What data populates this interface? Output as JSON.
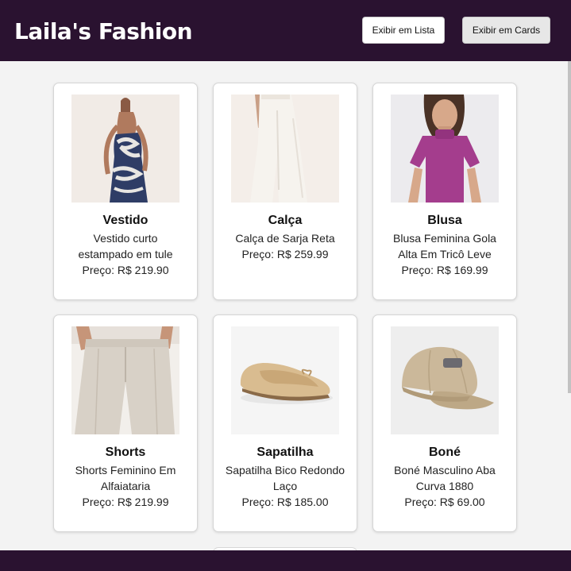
{
  "header": {
    "title": "Laila's Fashion",
    "list_button": "Exibir em Lista",
    "cards_button": "Exibir em Cards"
  },
  "products": [
    {
      "name": "Vestido",
      "description": "Vestido curto estampado em tule",
      "price": "Preço: R$ 219.90",
      "image": "dress-photo"
    },
    {
      "name": "Calça",
      "description": "Calça de Sarja Reta",
      "price": "Preço: R$ 259.99",
      "image": "pants-photo"
    },
    {
      "name": "Blusa",
      "description": "Blusa Feminina Gola Alta Em Tricô Leve",
      "price": "Preço: R$ 169.99",
      "image": "blouse-photo"
    },
    {
      "name": "Shorts",
      "description": "Shorts Feminino Em Alfaiataria",
      "price": "Preço: R$ 219.99",
      "image": "shorts-photo"
    },
    {
      "name": "Sapatilha",
      "description": "Sapatilha Bico Redondo Laço",
      "price": "Preço: R$ 185.00",
      "image": "flat-shoe-photo"
    },
    {
      "name": "Boné",
      "description": "Boné Masculino Aba Curva 1880",
      "price": "Preço: R$ 69.00",
      "image": "cap-photo"
    }
  ],
  "colors": {
    "header_bg": "#2a1230",
    "page_bg": "#f3f3f3",
    "card_bg": "#ffffff"
  }
}
